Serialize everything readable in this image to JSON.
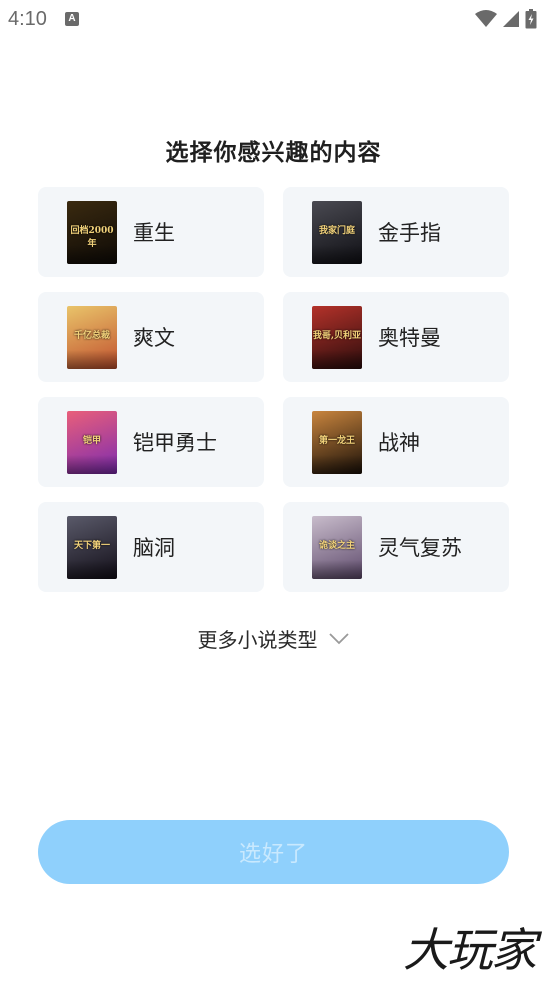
{
  "status_bar": {
    "time": "4:10",
    "notification_icon": "a-notification-icon",
    "wifi_icon": "wifi-icon",
    "signal_icon": "signal-icon",
    "battery_icon": "battery-icon"
  },
  "title": "选择你感兴趣的内容",
  "genres": [
    {
      "label": "重生",
      "cover_text": "回档2000年",
      "cover_colors": [
        "#3a2a10",
        "#0e0a06"
      ]
    },
    {
      "label": "金手指",
      "cover_text": "我家门庭",
      "cover_colors": [
        "#4a4a52",
        "#0f0f14"
      ]
    },
    {
      "label": "爽文",
      "cover_text": "千亿总裁",
      "cover_colors": [
        "#e9c46a",
        "#c1502e"
      ]
    },
    {
      "label": "奥特曼",
      "cover_text": "我哥,贝利亚",
      "cover_colors": [
        "#b4322a",
        "#2a0c0c"
      ]
    },
    {
      "label": "铠甲勇士",
      "cover_text": "铠甲",
      "cover_colors": [
        "#e95f7a",
        "#7c2bb0"
      ]
    },
    {
      "label": "战神",
      "cover_text": "第一龙王",
      "cover_colors": [
        "#c9853e",
        "#1a1008"
      ]
    },
    {
      "label": "脑洞",
      "cover_text": "天下第一",
      "cover_colors": [
        "#5a5a6a",
        "#120e18"
      ]
    },
    {
      "label": "灵气复苏",
      "cover_text": "诡谈之主",
      "cover_colors": [
        "#c8bccb",
        "#5e4a6c"
      ]
    }
  ],
  "more": {
    "label": "更多小说类型",
    "icon": "chevron-down-icon"
  },
  "confirm_button": {
    "label": "选好了"
  },
  "watermark": {
    "text": "大玩家"
  },
  "colors": {
    "card_bg": "#f3f6f9",
    "button_bg": "#8fd0fc",
    "button_text": "#c9e9fe"
  }
}
